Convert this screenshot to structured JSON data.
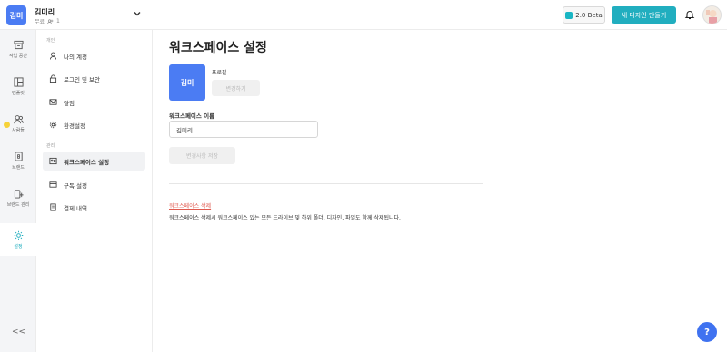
{
  "header": {
    "workspace_avatar": "김미",
    "workspace_name": "김미리",
    "plan": "무료",
    "member_count": "1",
    "beta_label": "2.0 Beta",
    "new_design_label": "새 디자인 만들기"
  },
  "rail": {
    "items": [
      {
        "label": "작업 공간",
        "icon": "archive-icon"
      },
      {
        "label": "템플릿",
        "icon": "layout-icon"
      },
      {
        "label": "사람들",
        "icon": "people-icon"
      },
      {
        "label": "브랜드",
        "icon": "brand-icon"
      },
      {
        "label": "브랜드 관리",
        "icon": "brand-manage-icon"
      },
      {
        "label": "설정",
        "icon": "gear-icon",
        "active": true
      }
    ],
    "collapse_label": "<<"
  },
  "sidebar": {
    "group_personal": "개인",
    "group_manage": "관리",
    "items": [
      {
        "label": "나의 계정",
        "icon": "user-icon"
      },
      {
        "label": "로그인 및 보안",
        "icon": "lock-icon"
      },
      {
        "label": "알림",
        "icon": "mail-icon"
      },
      {
        "label": "환경설정",
        "icon": "gear-icon"
      },
      {
        "label": "워크스페이스 설정",
        "icon": "workspace-icon",
        "active": true
      },
      {
        "label": "구독 설정",
        "icon": "card-icon"
      },
      {
        "label": "결제 내역",
        "icon": "receipt-icon"
      }
    ]
  },
  "main": {
    "title": "워크스페이스 설정",
    "profile_avatar": "김미",
    "profile_label": "프로필",
    "change_button": "변경하기",
    "name_label": "워크스페이스 이름",
    "name_value": "김미리",
    "save_button": "변경사항 저장",
    "delete_link": "워크스페이스 삭제",
    "delete_description": "워크스페이스 삭제시 워크스페이스 있는 모든 드라이브 및 하위 폴더, 디자인, 파일도 함께 삭제됩니다."
  },
  "help_label": "?",
  "colors": {
    "accent": "#21aebf",
    "avatar": "#4b7cf3",
    "danger": "#e05a4f",
    "help": "#3f72f0"
  }
}
